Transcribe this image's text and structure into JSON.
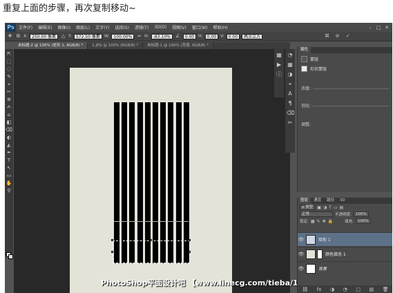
{
  "caption": "重复上面的步骤，再次复制移动~",
  "app": {
    "logo": "Ps"
  },
  "menu": [
    "文件(F)",
    "编辑(E)",
    "图像(I)",
    "图层(L)",
    "文字(Y)",
    "选择(S)",
    "滤镜(T)",
    "3D(D)",
    "视图(V)",
    "窗口(W)",
    "帮助(H)"
  ],
  "window_buttons": [
    "–",
    "□",
    "✕"
  ],
  "options": {
    "x_label": "X:",
    "x_value": "250.00 像素",
    "y_label": "Y:",
    "y_value": "572.50 像素",
    "w_label": "W:",
    "w_value": "100.00%",
    "h_label": "H:",
    "h_value": "-83.10%",
    "angle_value": "0.00",
    "hskew_label": "H:",
    "hskew_value": "0.00",
    "vskew_label": "V:",
    "vskew_value": "0.00",
    "interp": "两次立方"
  },
  "tabs": [
    {
      "label": "未标题-2 @ 100% (矩形 1, RGB/8) *",
      "active": true
    },
    {
      "label": "1.JPG @ 100% (RGB/8) *",
      "active": false
    },
    {
      "label": "未标题-1 @ 100% (背景, RGB/8) *",
      "active": false
    }
  ],
  "tools": [
    "⇱",
    "⬚",
    "◌",
    "✎",
    "⌖",
    "✂",
    "⊕",
    "✍",
    "⌂",
    "◧",
    "⌫",
    "◐",
    "◭",
    "✒",
    "T",
    "↖",
    "▭",
    "✋",
    "⚲"
  ],
  "properties": {
    "tabs": [
      "属性"
    ],
    "mask_label": "蒙版",
    "shape_mask_label": "形状蒙版",
    "density_label": "浓度:",
    "feather_label": "羽化:",
    "adjust_label": "调整:"
  },
  "layers": {
    "tabs": [
      "图层",
      "通道",
      "路径",
      "3D"
    ],
    "kind_label": "ρ 类型",
    "blend_mode": "正常",
    "opacity_label": "不透明度:",
    "opacity_value": "100%",
    "lock_label": "锁定:",
    "fill_label": "填充:",
    "fill_value": "100%",
    "items": [
      {
        "name": "矩形 1",
        "selected": true,
        "thumb": "#cfd8e6"
      },
      {
        "name": "颜色填充 1",
        "selected": false,
        "thumb": "#e3e3d8"
      },
      {
        "name": "背景",
        "selected": false,
        "thumb": "#ffffff"
      }
    ],
    "footer_icons": [
      "⛓",
      "fx",
      "◑",
      "◔",
      "▢",
      "▤",
      "🗑"
    ]
  },
  "watermark": "PhotoShop平面设计吧 【www.linecg.com/tieba/1783】"
}
